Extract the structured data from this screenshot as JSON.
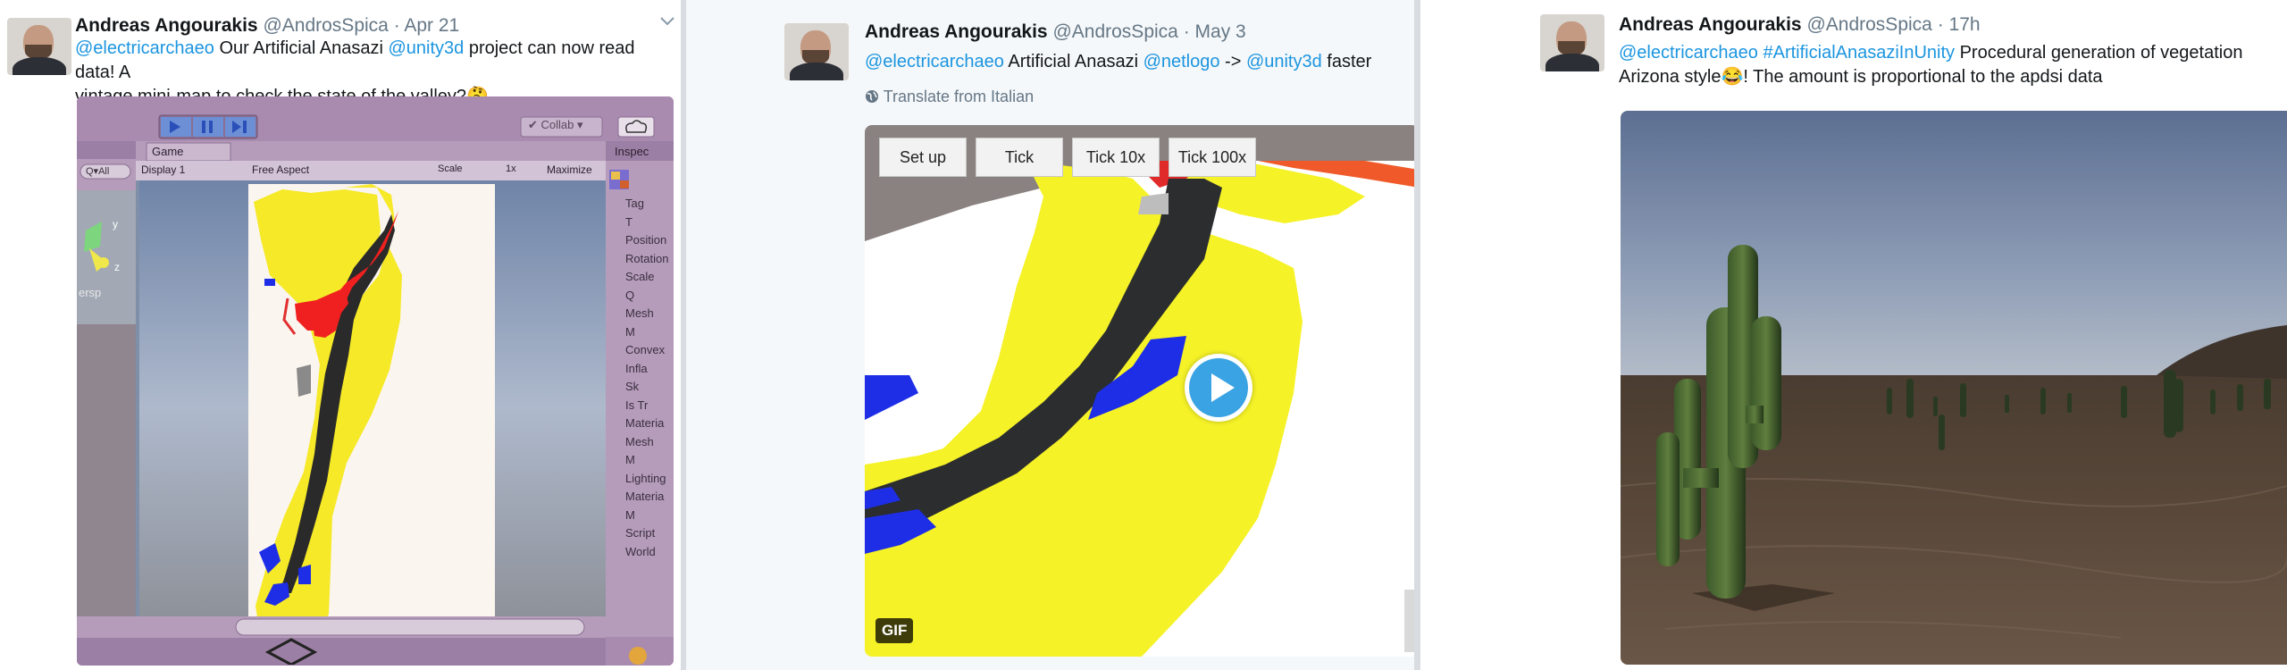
{
  "tweets": [
    {
      "author": "Andreas Angourakis",
      "handle": "@AndrosSpica",
      "date": "· Apr 21",
      "mention1": "@electricarchaeo",
      "text_a": " Our Artificial Anasazi ",
      "mention2": "@unity3d",
      "text_b": " project can now read data! A",
      "line2": "vintage mini-map to check the state of the valley?",
      "emoji": "🤔",
      "unity": {
        "collab": "✔ Collab ▾",
        "game_tab": "Game",
        "display": "Display 1",
        "aspect": "Free Aspect",
        "scale_label": "Scale",
        "scale_value": "1x",
        "maximize": "Maximize",
        "all_search": "Q▾All",
        "persp": "ersp",
        "axis_y": "y",
        "axis_z": "z",
        "inspector_tab": "Inspec",
        "inspector_rows": [
          "Tag",
          "T",
          "Position",
          "Rotation",
          "Scale",
          "Q",
          "Mesh",
          "M",
          "Convex",
          "Infla",
          "Sk",
          "Is Tr",
          "Materia",
          "Mesh",
          "M",
          "Lighting",
          "Materia",
          "M",
          "Script",
          "World"
        ]
      }
    },
    {
      "author": "Andreas Angourakis",
      "handle": "@AndrosSpica",
      "date": "· May 3",
      "mention1": "@electricarchaeo",
      "text_a": " Artificial Anasazi ",
      "mention2": "@netlogo",
      "text_b": " -> ",
      "mention3": "@unity3d",
      "text_c": " faster",
      "translate": "Translate from Italian",
      "buttons": [
        "Set up",
        "Tick",
        "Tick 10x",
        "Tick 100x"
      ],
      "gif_badge": "GIF"
    },
    {
      "author": "Andreas Angourakis",
      "handle": "@AndrosSpica",
      "date": "· 17h",
      "mention1": "@electricarchaeo",
      "hashtag": "#ArtificialAnasaziInUnity",
      "text_a": " Procedural generation of vegetation",
      "line2_a": "Arizona style",
      "emoji": "😂",
      "line2_b": "! The amount is proportional to the apdsi data"
    }
  ],
  "colors": {
    "link": "#1b95e0",
    "handle": "#657786",
    "unity_panel": "#a98bb0",
    "map_yellow": "#f5e928",
    "map_red": "#f02020",
    "map_blue": "#1e2ee6",
    "map_dark": "#2a2a2a"
  },
  "icons": [
    "chevron-down-icon",
    "globe-icon",
    "play-icon",
    "unity-logo-icon",
    "cactus-icon"
  ]
}
